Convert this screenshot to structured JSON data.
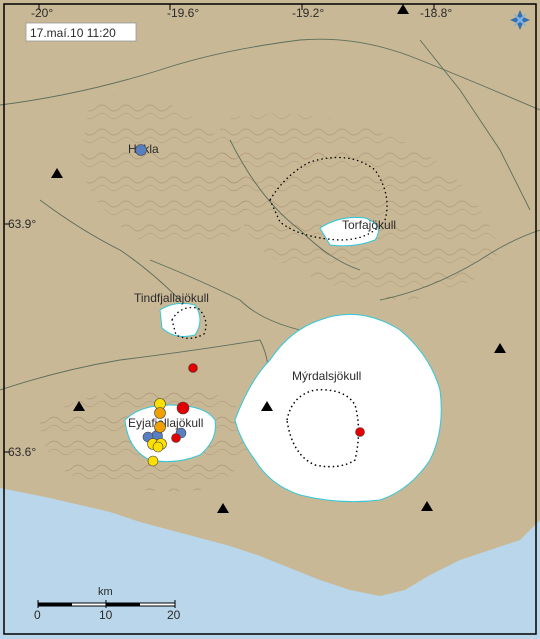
{
  "timestamp": "17.maí.10  11:20",
  "longitude_labels": [
    "-20°",
    "-19.6°",
    "-19.2°",
    "-18.8°"
  ],
  "latitude_labels": [
    "63.9°",
    "63.6°"
  ],
  "places": {
    "hekla": "Hekla",
    "torfajokull": "Torfajökull",
    "tindfjallajokull": "Tindfjallajökull",
    "myrdalsjokull": "Mýrdalsjökull",
    "eyjafjallajokull": "Eyjafjallajökull"
  },
  "scale": {
    "unit": "km",
    "labels": [
      "0",
      "10",
      "20"
    ]
  },
  "legend_colors": {
    "red": "#e00000",
    "orange": "#f0a000",
    "yellow": "#ffe000",
    "blue": "#5a7fc0",
    "land": "#c8b896",
    "sea": "#b9d6ea",
    "glacier_outline": "#33c8d8"
  },
  "icons": {
    "logo": "imo-star-logo",
    "station": "black-triangle-station"
  }
}
